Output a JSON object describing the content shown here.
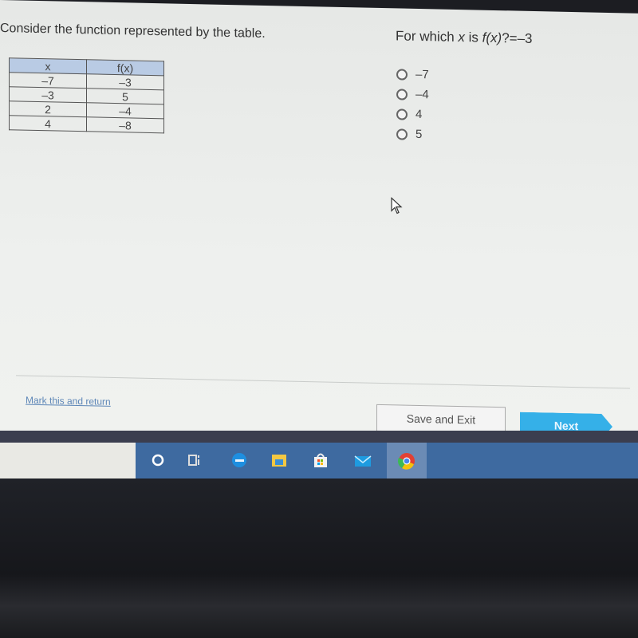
{
  "question": {
    "prompt_left": "Consider the function represented by the table.",
    "prompt_right_prefix": "For which ",
    "prompt_right_var": "x",
    "prompt_right_mid": " is ",
    "prompt_right_fx": "f(x)",
    "prompt_right_suffix": "?=–3"
  },
  "table": {
    "headers": [
      "x",
      "f(x)"
    ],
    "rows": [
      [
        "–7",
        "–3"
      ],
      [
        "–3",
        "5"
      ],
      [
        "2",
        "–4"
      ],
      [
        "4",
        "–8"
      ]
    ]
  },
  "options": [
    "–7",
    "–4",
    "4",
    "5"
  ],
  "footer": {
    "mark_label": "Mark this and return",
    "save_label": "Save and Exit",
    "next_label": "Next"
  },
  "taskbar": {
    "icons": [
      "cortana-icon",
      "task-view-icon",
      "edge-icon",
      "file-explorer-icon",
      "store-icon",
      "mail-icon",
      "chrome-icon"
    ]
  }
}
